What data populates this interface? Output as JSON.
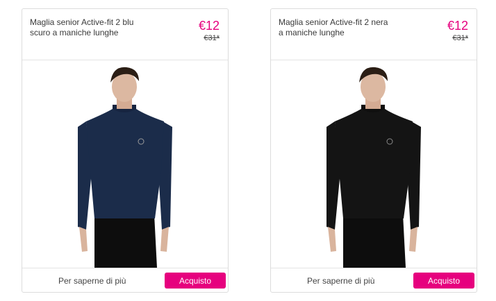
{
  "products": [
    {
      "title": "Maglia senior Active-fit 2 blu scuro a maniche lunghe",
      "price": "€12",
      "old_price": "€31*",
      "more_label": "Per saperne di più",
      "buy_label": "Acquisto",
      "shirt_color": "#1b2c4a"
    },
    {
      "title": "Maglia senior Active-fit 2 nera a maniche lunghe",
      "price": "€12",
      "old_price": "€31*",
      "more_label": "Per saperne di più",
      "buy_label": "Acquisto",
      "shirt_color": "#141414"
    }
  ],
  "colors": {
    "accent": "#e6007e"
  }
}
